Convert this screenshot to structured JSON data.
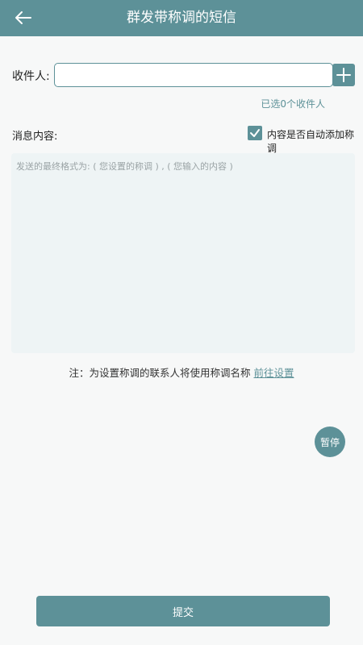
{
  "header": {
    "title": "群发带称调的短信",
    "back_icon": "arrow-left-icon"
  },
  "recipients": {
    "label": "收件人:",
    "value": "",
    "placeholder": "",
    "add_icon": "plus-icon",
    "selected_text": "已选0个收件人"
  },
  "message": {
    "label": "消息内容:",
    "auto_title_label": "内容是否自动添加称调",
    "auto_title_checked": true,
    "value": "",
    "placeholder": "发送的最终格式为: ( 您设置的称调 ) , ( 您输入的内容 )"
  },
  "note": {
    "text": "注：为设置称调的联系人将使用称调名称",
    "link": "前往设置"
  },
  "pause_button": "暂停",
  "submit_button": "提交",
  "colors": {
    "accent": "#5d9198",
    "background": "#f7f8f8",
    "textarea_bg": "#eef4f5"
  }
}
